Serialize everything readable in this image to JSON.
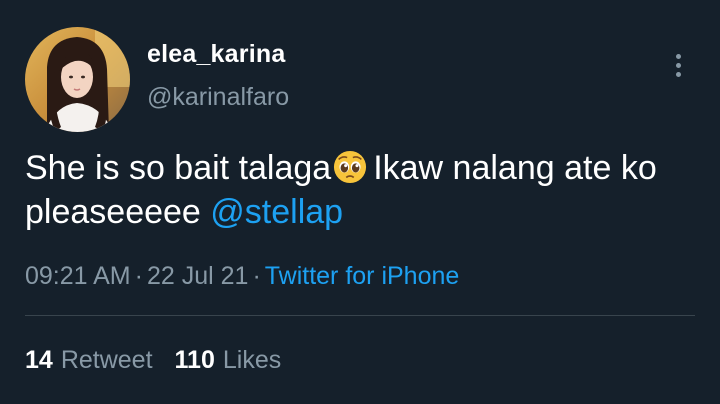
{
  "author": {
    "display_name": "elea_karina",
    "handle": "@karinalfaro",
    "avatar_icon": "profile-photo"
  },
  "tweet": {
    "text_part1": "She is so bait talaga",
    "emoji": "pleading-face-emoji",
    "text_part2": "Ikaw nalang ate ko pleaseeeee",
    "mention": "@stellap"
  },
  "meta": {
    "time": "09:21 AM",
    "separator": "·",
    "date": "22 Jul 21",
    "source": "Twitter for iPhone"
  },
  "stats": {
    "retweets_count": "14",
    "retweets_label": "Retweet",
    "likes_count": "110",
    "likes_label": "Likes"
  },
  "colors": {
    "background": "#15202b",
    "text_primary": "#ffffff",
    "text_secondary": "#8899a6",
    "accent": "#1da1f2",
    "divider": "#38444d"
  }
}
